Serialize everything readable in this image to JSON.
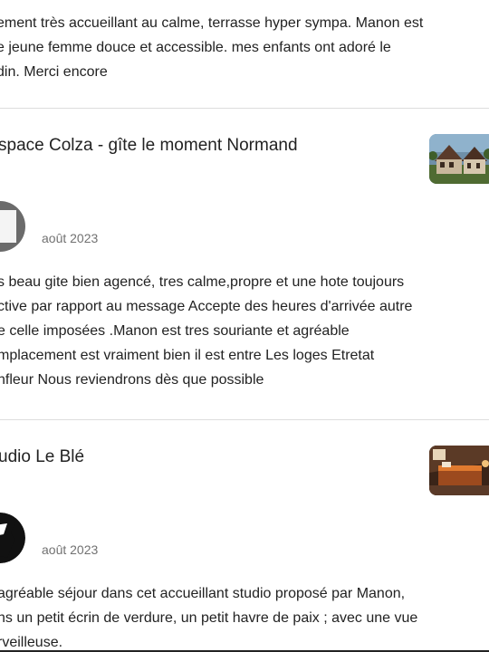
{
  "reviews": [
    {
      "text_lines": [
        "ement très accueillant au calme, terrasse hyper sympa. Manon est",
        "e jeune femme douce et accessible. mes enfants ont adoré le",
        "din. Merci encore"
      ]
    },
    {
      "listing_title": "space Colza - gîte le moment Normand",
      "date": "août 2023",
      "text_lines": [
        "s beau gite bien agencé, tres calme,propre et une hote toujours",
        "ctive par rapport au message Accepte des heures d'arrivée autre",
        "e celle imposées .Manon est tres souriante et agréable",
        "mplacement est vraiment bien il est entre Les loges Etretat",
        "nfleur Nous reviendrons dès que possible"
      ]
    },
    {
      "listing_title": "udio Le Blé",
      "date": "août 2023",
      "text_lines": [
        "agréable séjour dans cet accueillant studio proposé par Manon,",
        "ns un petit écrin de verdure, un petit havre de paix ; avec une vue",
        "rveilleuse."
      ]
    }
  ],
  "colors": {
    "text": "#222222",
    "secondary_text": "#717171",
    "divider": "#dddddd"
  },
  "icons": {
    "listing_thumbnail_1": "house-photo",
    "listing_thumbnail_2": "bedroom-photo",
    "reviewer_avatar_1": "reviewer-avatar",
    "reviewer_avatar_2": "reviewer-avatar"
  }
}
